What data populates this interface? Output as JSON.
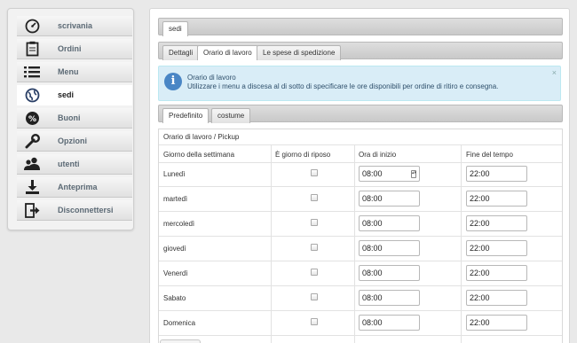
{
  "sidebar": {
    "items": [
      {
        "label": "scrivania",
        "icon": "dashboard-icon"
      },
      {
        "label": "Ordini",
        "icon": "clipboard-icon"
      },
      {
        "label": "Menu",
        "icon": "list-icon"
      },
      {
        "label": "sedi",
        "icon": "globe-icon",
        "active": true
      },
      {
        "label": "Buoni",
        "icon": "percent-icon"
      },
      {
        "label": "Opzioni",
        "icon": "wrench-icon"
      },
      {
        "label": "utenti",
        "icon": "users-icon"
      },
      {
        "label": "Anteprima",
        "icon": "download-icon"
      },
      {
        "label": "Disconnettersi",
        "icon": "logout-icon"
      }
    ]
  },
  "main": {
    "top_tab": "sedi",
    "tabs": [
      "Dettagli",
      "Orario di lavoro",
      "Le spese di spedizione"
    ],
    "active_tab": "Orario di lavoro"
  },
  "info": {
    "title": "Orario di lavoro",
    "text": "Utilizzare i menu a discesa al di sotto di specificare le ore disponibili per ordine di ritiro e consegna.",
    "close": "×",
    "icon": "info-icon"
  },
  "schedule_tabs": [
    "Predefinito",
    "costume"
  ],
  "schedule": {
    "caption": "Orario di lavoro / Pickup",
    "columns": [
      "Giorno della settimana",
      "È giorno di riposo",
      "Ora di inizio",
      "Fine del tempo"
    ],
    "rows": [
      {
        "day": "Lunedì",
        "start": "08:00",
        "end": "22:00"
      },
      {
        "day": "martedì",
        "start": "08:00",
        "end": "22:00"
      },
      {
        "day": "mercoledì",
        "start": "08:00",
        "end": "22:00"
      },
      {
        "day": "giovedì",
        "start": "08:00",
        "end": "22:00"
      },
      {
        "day": "Venerdì",
        "start": "08:00",
        "end": "22:00"
      },
      {
        "day": "Sabato",
        "start": "08:00",
        "end": "22:00"
      },
      {
        "day": "Domenica",
        "start": "08:00",
        "end": "22:00"
      }
    ]
  },
  "colors": {
    "info_bg": "#d9edf7",
    "info_icon": "#4a86c5",
    "sidebar_label": "#5c6a75"
  }
}
